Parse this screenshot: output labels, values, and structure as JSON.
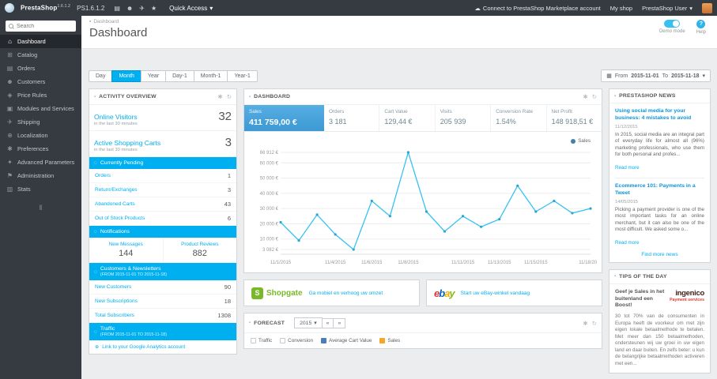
{
  "colors": {
    "accent_cyan": "#00aff0",
    "topbar_bg": "#363a41",
    "kpi_active_blue": "#459fd4",
    "chart_line": "#35c2f2",
    "chart_point": "#2aa6cf",
    "legend_avg_cart": "#4a7ebb",
    "legend_sales": "#f5a623"
  },
  "ui_icons": {
    "settings": "✱",
    "refresh": "↻",
    "caret_down": "▾",
    "calendar": "▦",
    "cloud": "☁",
    "panel_caret": "▪",
    "link": "⊕",
    "clock": "◌"
  },
  "topbar": {
    "brand": "PrestaShop",
    "brand_version": "1.6.1.2",
    "shop_name": "PS1.6.1.2",
    "icons": [
      {
        "name": "cart-icon",
        "glyph": "▤"
      },
      {
        "name": "customers-icon",
        "glyph": "☻"
      },
      {
        "name": "messages-icon",
        "glyph": "✈"
      },
      {
        "name": "trophy-icon",
        "glyph": "★"
      }
    ],
    "quick_access": "Quick Access",
    "marketplace_link": "Connect to PrestaShop Marketplace account",
    "my_shop": "My shop",
    "user_menu": "PrestaShop User"
  },
  "sidebar": {
    "search_placeholder": "Search",
    "items": [
      {
        "label": "Dashboard",
        "icon": "home-icon",
        "glyph": "⌂"
      },
      {
        "label": "Catalog",
        "icon": "catalog-icon",
        "glyph": "⊞"
      },
      {
        "label": "Orders",
        "icon": "orders-icon",
        "glyph": "▤"
      },
      {
        "label": "Customers",
        "icon": "customers-icon",
        "glyph": "☻"
      },
      {
        "label": "Price Rules",
        "icon": "price-rules-icon",
        "glyph": "◈"
      },
      {
        "label": "Modules and Services",
        "icon": "modules-icon",
        "glyph": "▣"
      },
      {
        "label": "Shipping",
        "icon": "shipping-icon",
        "glyph": "✈"
      },
      {
        "label": "Localization",
        "icon": "localization-icon",
        "glyph": "⊕"
      },
      {
        "label": "Preferences",
        "icon": "preferences-icon",
        "glyph": "✱"
      },
      {
        "label": "Advanced Parameters",
        "icon": "advanced-parameters-icon",
        "glyph": "✦"
      },
      {
        "label": "Administration",
        "icon": "administration-icon",
        "glyph": "⚑"
      },
      {
        "label": "Stats",
        "icon": "stats-icon",
        "glyph": "▥"
      }
    ]
  },
  "header": {
    "breadcrumb": "Dashboard",
    "title": "Dashboard",
    "demo_label": "Demo mode",
    "help_label": "Help"
  },
  "filters": {
    "buttons": [
      "Day",
      "Month",
      "Year",
      "Day-1",
      "Month-1",
      "Year-1"
    ],
    "active": "Month",
    "from_label": "From",
    "from_date": "2015-11-01",
    "to_label": "To",
    "to_date": "2015-11-18"
  },
  "activity": {
    "title": "ACTIVITY OVERVIEW",
    "online_visitors": {
      "label": "Online Visitors",
      "value": "32",
      "sub": "in the last 30 minutes"
    },
    "active_carts": {
      "label": "Active Shopping Carts",
      "value": "3",
      "sub": "in the last 30 minutes"
    },
    "pending": {
      "title": "Currently Pending",
      "rows": [
        {
          "label": "Orders",
          "value": "1"
        },
        {
          "label": "Return/Exchanges",
          "value": "3"
        },
        {
          "label": "Abandoned Carts",
          "value": "43"
        },
        {
          "label": "Out of Stock Products",
          "value": "6"
        }
      ]
    },
    "notifications": {
      "title": "Notifications",
      "cells": [
        {
          "label": "New Messages",
          "value": "144"
        },
        {
          "label": "Product Reviews",
          "value": "882"
        }
      ]
    },
    "customers": {
      "title": "Customers & Newsletters",
      "subtitle": "(FROM 2015-11-01 TO 2015-11-18)",
      "rows": [
        {
          "label": "New Customers",
          "value": "90"
        },
        {
          "label": "New Subscriptions",
          "value": "18"
        },
        {
          "label": "Total Subscribers",
          "value": "1308"
        }
      ]
    },
    "traffic": {
      "title": "Traffic",
      "subtitle": "(FROM 2015-11-01 TO 2015-11-18)",
      "link": "Link to your Google Analytics account"
    }
  },
  "dashboard_panel": {
    "title": "DASHBOARD",
    "kpis": [
      {
        "label": "Sales",
        "value": "411 759,00 €"
      },
      {
        "label": "Orders",
        "value": "3 181"
      },
      {
        "label": "Cart Value",
        "value": "129,44 €"
      },
      {
        "label": "Visits",
        "value": "205 939"
      },
      {
        "label": "Conversion Rate",
        "value": "1.54%"
      },
      {
        "label": "Net Profit",
        "value": "148 918,51 €"
      }
    ],
    "legend": "Sales",
    "chart_data": {
      "type": "line",
      "title": "Sales",
      "x": [
        "11/1/2015",
        "11/2/2015",
        "11/3/2015",
        "11/4/2015",
        "11/5/2015",
        "11/6/2015",
        "11/7/2015",
        "11/8/2015",
        "11/9/2015",
        "11/10/2015",
        "11/11/2015",
        "11/12/2015",
        "11/13/2015",
        "11/14/2015",
        "11/15/2015",
        "11/16/2015",
        "11/17/2015",
        "11/18/2015"
      ],
      "values": [
        21000,
        9000,
        26000,
        13000,
        3082,
        35000,
        25000,
        66912,
        28000,
        15000,
        25000,
        18000,
        23000,
        45000,
        28000,
        35000,
        27000,
        30000
      ],
      "ylim": [
        0,
        70000
      ],
      "y_ticks": [
        {
          "value": 66912,
          "label": "66 912 €"
        },
        {
          "value": 60000,
          "label": "60 000 €"
        },
        {
          "value": 50000,
          "label": "50 000 €"
        },
        {
          "value": 40000,
          "label": "40 000 €"
        },
        {
          "value": 30000,
          "label": "30 000 €"
        },
        {
          "value": 20000,
          "label": "20 000 €"
        },
        {
          "value": 10000,
          "label": "10 000 €"
        },
        {
          "value": 3082,
          "label": "3 082 €"
        }
      ],
      "x_ticks": [
        {
          "index": 0,
          "label": "11/1/2015"
        },
        {
          "index": 3,
          "label": "11/4/2015"
        },
        {
          "index": 5,
          "label": "11/6/2015"
        },
        {
          "index": 7,
          "label": "11/8/2015"
        },
        {
          "index": 10,
          "label": "11/11/2015"
        },
        {
          "index": 12,
          "label": "11/13/2015"
        },
        {
          "index": 14,
          "label": "11/15/2015"
        },
        {
          "index": 17,
          "label": "11/18/2015"
        }
      ],
      "legend_entries": [
        "Sales"
      ],
      "grid": true,
      "legend_position": "top-right"
    }
  },
  "partners": [
    {
      "name": "Shopgate",
      "initial": "S",
      "link": "Ga mobiel en verhoog uw omzet"
    },
    {
      "name": "ebay",
      "letters": [
        "e",
        "b",
        "a",
        "y"
      ],
      "link": "Start uw eBay-winkel vandaag"
    }
  ],
  "forecast": {
    "title": "FORECAST",
    "year": "2015",
    "prev_arrow": "«",
    "next_arrow": "»",
    "legend": [
      {
        "label": "Traffic",
        "color": "#ffffff"
      },
      {
        "label": "Conversion",
        "color": "#ffffff"
      },
      {
        "label": "Average Cart Value",
        "color": "#4a7ebb"
      },
      {
        "label": "Sales",
        "color": "#f5a623"
      }
    ]
  },
  "news": {
    "title": "PRESTASHOP NEWS",
    "articles": [
      {
        "title": "Using social media for your business: 4 mistakes to avoid",
        "date": "11/12/2015",
        "excerpt": "In 2015, social media are an integral part of everyday life for almost all (96%) marketing professionals, who use them for both personal and profes...",
        "read_more": "Read more"
      },
      {
        "title": "Ecommerce 101: Payments in a Tweet",
        "date": "14/05/2015",
        "excerpt": "Picking a payment provider is one of the most important tasks for an online merchant, but it can also be one of the most difficult. We asked some o...",
        "read_more": "Read more"
      }
    ],
    "more": "Find more news"
  },
  "tips": {
    "title": "TIPS OF THE DAY",
    "headline": "Geef je Sales in het buitenland een Boost!",
    "brand": "ingenico",
    "brand_sub": "Payment services",
    "body": "30 tot 70% van de consumenten in Europa heeft de voorkeur om met zijn eigen lokale betaalmethode te betalen. Met meer dan 150 betaalmethoden, ondersteunen wij uw groei in uw eigen land en daar buiten. En zelfs beter: u kun de belangrijke betaalmethoden activeren met een..."
  }
}
